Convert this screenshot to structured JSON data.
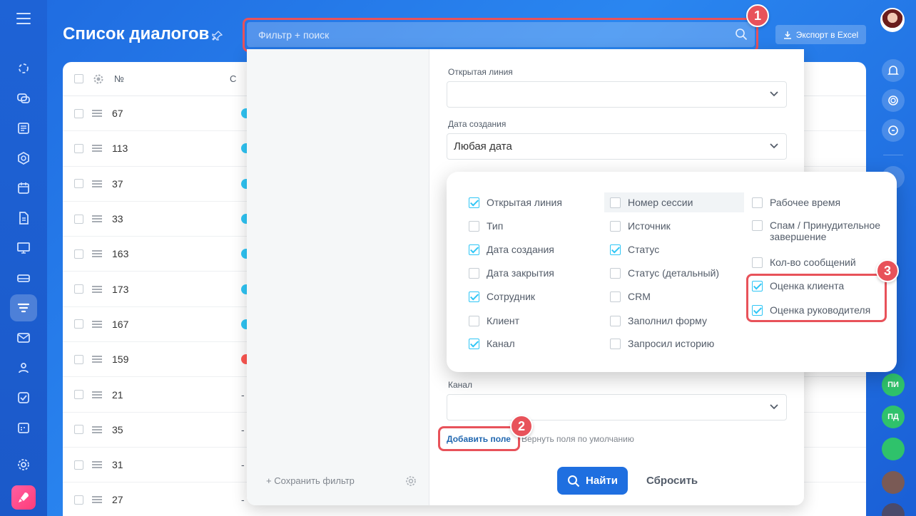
{
  "header": {
    "title": "Список диалогов",
    "search_placeholder": "Фильтр + поиск",
    "export_label": "Экспорт в Excel"
  },
  "annotations": {
    "badge1": "1",
    "badge2": "2",
    "badge3": "3"
  },
  "list": {
    "column_no": "№",
    "column_c": "С",
    "rows": [
      {
        "id": "67",
        "color": "#2fc6f6"
      },
      {
        "id": "113",
        "color": "#2fc6f6"
      },
      {
        "id": "37",
        "color": "#2fc6f6"
      },
      {
        "id": "33",
        "color": "#2fc6f6"
      },
      {
        "id": "163",
        "color": "#2fc6f6"
      },
      {
        "id": "173",
        "color": "#2fc6f6"
      },
      {
        "id": "167",
        "color": "#2fc6f6"
      },
      {
        "id": "159",
        "color": "#ff5752"
      },
      {
        "id": "21",
        "color": ""
      },
      {
        "id": "35",
        "color": ""
      },
      {
        "id": "31",
        "color": ""
      },
      {
        "id": "27",
        "color": ""
      }
    ]
  },
  "filter": {
    "open_line_label": "Открытая линия",
    "open_line_value": "",
    "date_created_label": "Дата создания",
    "date_created_value": "Любая дата",
    "channel_label": "Канал",
    "channel_value": "",
    "add_field": "Добавить поле",
    "default_fields": "Вернуть поля по умолчанию",
    "find": "Найти",
    "reset": "Сбросить",
    "save_filter": "Сохранить фильтр"
  },
  "chooser": {
    "col1": [
      {
        "label": "Открытая линия",
        "checked": true
      },
      {
        "label": "Тип",
        "checked": false
      },
      {
        "label": "Дата создания",
        "checked": true
      },
      {
        "label": "Дата закрытия",
        "checked": false
      },
      {
        "label": "Сотрудник",
        "checked": true
      },
      {
        "label": "Клиент",
        "checked": false
      },
      {
        "label": "Канал",
        "checked": true
      }
    ],
    "col2": [
      {
        "label": "Номер сессии",
        "checked": false
      },
      {
        "label": "Источник",
        "checked": false
      },
      {
        "label": "Статус",
        "checked": true
      },
      {
        "label": "Статус (детальный)",
        "checked": false
      },
      {
        "label": "CRM",
        "checked": false
      },
      {
        "label": "Заполнил форму",
        "checked": false
      },
      {
        "label": "Запросил историю",
        "checked": false
      }
    ],
    "col3": [
      {
        "label": "Рабочее время",
        "checked": false
      },
      {
        "label": "Спам / Принудительное завершение",
        "checked": false
      },
      {
        "label": "Кол-во сообщений",
        "checked": false
      },
      {
        "label": "Оценка клиента",
        "checked": true
      },
      {
        "label": "Оценка руководителя",
        "checked": true
      }
    ]
  },
  "right_users": [
    {
      "initials": "ПИ",
      "color": "#2fc26b"
    },
    {
      "initials": "ПД",
      "color": "#2fc26b"
    }
  ]
}
